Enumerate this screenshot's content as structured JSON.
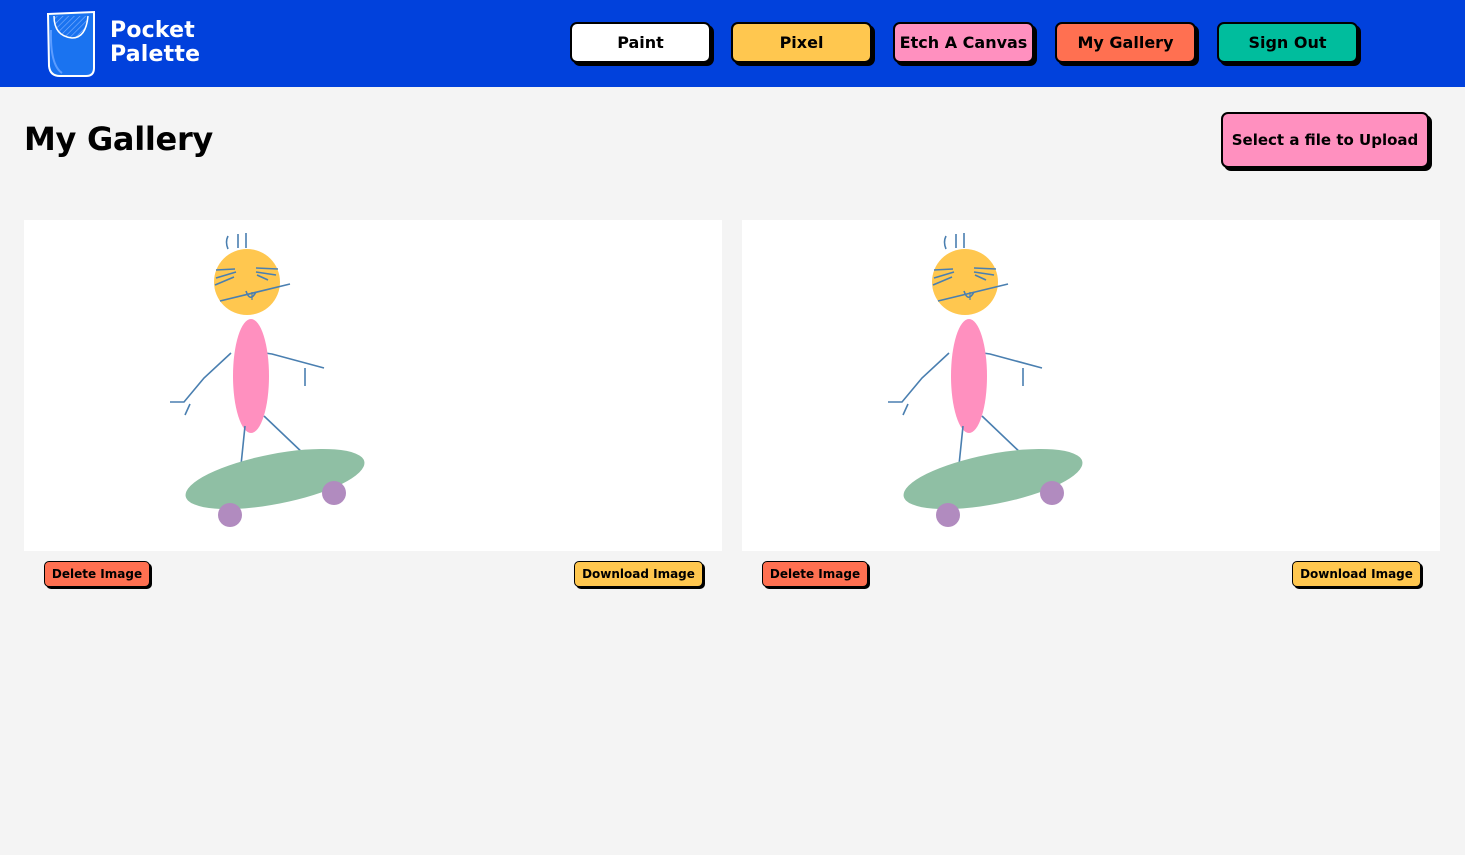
{
  "brand": {
    "line1": "Pocket",
    "line2": "Palette",
    "icon": "pocket-icon"
  },
  "nav": [
    {
      "label": "Paint",
      "color": "#ffffff"
    },
    {
      "label": "Pixel",
      "color": "#ffc74f"
    },
    {
      "label": "Etch A Canvas",
      "color": "#ff90bf"
    },
    {
      "label": "My Gallery",
      "color": "#ff7051"
    },
    {
      "label": "Sign Out",
      "color": "#00bd9d"
    }
  ],
  "page": {
    "title": "My Gallery",
    "upload_label": "Select a file to Upload"
  },
  "gallery": [
    {
      "delete_label": "Delete Image",
      "download_label": "Download Image"
    },
    {
      "delete_label": "Delete Image",
      "download_label": "Download Image"
    }
  ],
  "colors": {
    "header": "#0141dc",
    "background": "#f4f4f4",
    "delete": "#ff7051",
    "download": "#ffc74f",
    "upload": "#ff90bf"
  }
}
